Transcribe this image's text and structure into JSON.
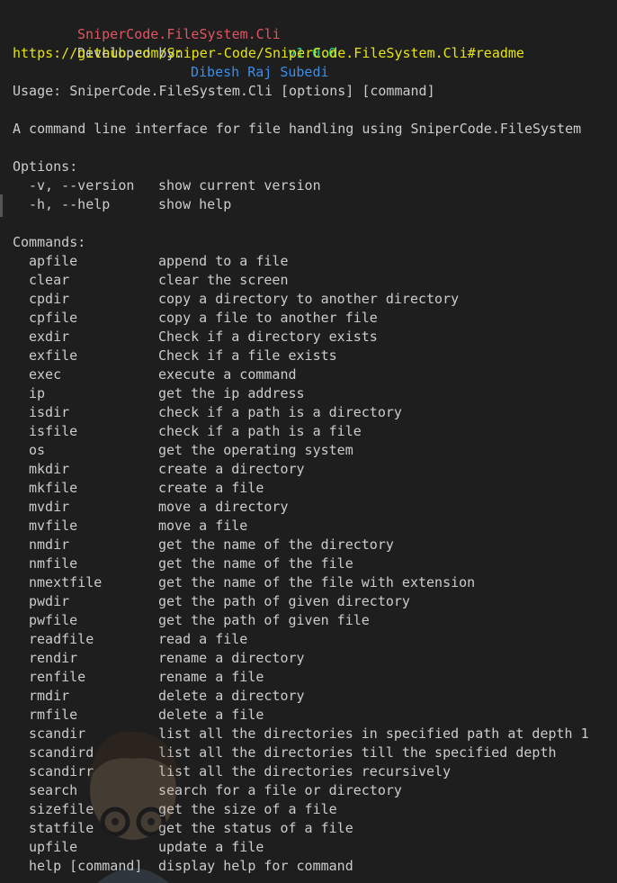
{
  "header": {
    "app_name": "SniperCode.FileSystem.Cli",
    "version": "v1.0.0",
    "developed_by_label": "Developed by:",
    "author": "Dibesh Raj Subedi",
    "url": "https://github.com/Sniper-Code/SniperCode.FileSystem.Cli#readme"
  },
  "usage": "Usage: SniperCode.FileSystem.Cli [options] [command]",
  "description": "A command line interface for file handling using SniperCode.FileSystem",
  "options_heading": "Options:",
  "options": [
    {
      "flag": "-v, --version",
      "desc": "show current version"
    },
    {
      "flag": "-h, --help",
      "desc": "show help"
    }
  ],
  "commands_heading": "Commands:",
  "commands": [
    {
      "name": "apfile",
      "desc": "append to a file"
    },
    {
      "name": "clear",
      "desc": "clear the screen"
    },
    {
      "name": "cpdir",
      "desc": "copy a directory to another directory"
    },
    {
      "name": "cpfile",
      "desc": "copy a file to another file"
    },
    {
      "name": "exdir",
      "desc": "Check if a directory exists"
    },
    {
      "name": "exfile",
      "desc": "Check if a file exists"
    },
    {
      "name": "exec",
      "desc": "execute a command"
    },
    {
      "name": "ip",
      "desc": "get the ip address"
    },
    {
      "name": "isdir",
      "desc": "check if a path is a directory"
    },
    {
      "name": "isfile",
      "desc": "check if a path is a file"
    },
    {
      "name": "os",
      "desc": "get the operating system"
    },
    {
      "name": "mkdir",
      "desc": "create a directory"
    },
    {
      "name": "mkfile",
      "desc": "create a file"
    },
    {
      "name": "mvdir",
      "desc": "move a directory"
    },
    {
      "name": "mvfile",
      "desc": "move a file"
    },
    {
      "name": "nmdir",
      "desc": "get the name of the directory"
    },
    {
      "name": "nmfile",
      "desc": "get the name of the file"
    },
    {
      "name": "nmextfile",
      "desc": "get the name of the file with extension"
    },
    {
      "name": "pwdir",
      "desc": "get the path of given directory"
    },
    {
      "name": "pwfile",
      "desc": "get the path of given file"
    },
    {
      "name": "readfile",
      "desc": "read a file"
    },
    {
      "name": "rendir",
      "desc": "rename a directory"
    },
    {
      "name": "renfile",
      "desc": "rename a file"
    },
    {
      "name": "rmdir",
      "desc": "delete a directory"
    },
    {
      "name": "rmfile",
      "desc": "delete a file"
    },
    {
      "name": "scandir",
      "desc": "list all the directories in specified path at depth 1"
    },
    {
      "name": "scandird",
      "desc": "list all the directories till the specified depth"
    },
    {
      "name": "scandirr",
      "desc": "list all the directories recursively"
    },
    {
      "name": "search",
      "desc": "search for a file or directory"
    },
    {
      "name": "sizefile",
      "desc": "get the size of a file"
    },
    {
      "name": "statfile",
      "desc": "get the status of a file"
    },
    {
      "name": "upfile",
      "desc": "update a file"
    },
    {
      "name": "help [command]",
      "desc": "display help for command"
    }
  ],
  "colors": {
    "background": "#1e1e1e",
    "text": "#cccccc",
    "app_name": "#e05561",
    "version": "#23d18b",
    "author": "#3b8eea",
    "url": "#e5e510"
  }
}
